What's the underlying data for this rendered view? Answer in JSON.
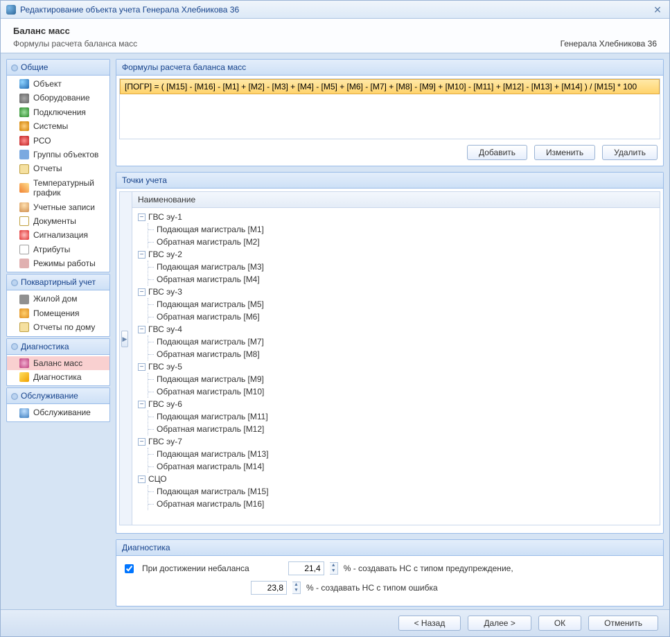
{
  "window": {
    "title": "Редактирование объекта учета Генерала Хлебникова 36"
  },
  "header": {
    "title": "Баланс масс",
    "subtitle": "Формулы расчета баланса масс",
    "object": "Генерала Хлебникова 36"
  },
  "sidebar": {
    "sections": {
      "common": {
        "title": "Общие",
        "items": [
          "Объект",
          "Оборудование",
          "Подключения",
          "Системы",
          "РСО",
          "Группы объектов",
          "Отчеты",
          "Температурный график",
          "Учетные записи",
          "Документы",
          "Сигнализация",
          "Атрибуты",
          "Режимы работы"
        ]
      },
      "apartment": {
        "title": "Поквартирный учет",
        "items": [
          "Жилой дом",
          "Помещения",
          "Отчеты по дому"
        ]
      },
      "diagnostics": {
        "title": "Диагностика",
        "items": [
          "Баланс масс",
          "Диагностика"
        ],
        "selected": 0
      },
      "service": {
        "title": "Обслуживание",
        "items": [
          "Обслуживание"
        ]
      }
    }
  },
  "formulas": {
    "panel_title": "Формулы расчета баланса масс",
    "row": "[ПОГР] = ( [M15] - [M16] - [M1] + [M2] - [M3] + [M4] - [M5] + [M6] - [M7] + [M8] - [M9] + [M10] - [M11] + [M12] - [M13] + [M14] ) / [M15] * 100",
    "buttons": {
      "add": "Добавить",
      "edit": "Изменить",
      "delete": "Удалить"
    }
  },
  "points": {
    "panel_title": "Точки учета",
    "column": "Наименование",
    "nodes": [
      {
        "label": "ГВС эу-1",
        "children": [
          "Подающая магистраль [M1]",
          "Обратная магистраль [M2]"
        ]
      },
      {
        "label": "ГВС эу-2",
        "children": [
          "Подающая магистраль [M3]",
          "Обратная магистраль [M4]"
        ]
      },
      {
        "label": "ГВС эу-3",
        "children": [
          "Подающая магистраль [M5]",
          "Обратная магистраль [M6]"
        ]
      },
      {
        "label": "ГВС эу-4",
        "children": [
          "Подающая магистраль [M7]",
          "Обратная магистраль [M8]"
        ]
      },
      {
        "label": "ГВС эу-5",
        "children": [
          "Подающая магистраль [M9]",
          "Обратная магистраль [M10]"
        ]
      },
      {
        "label": "ГВС эу-6",
        "children": [
          "Подающая магистраль [M11]",
          "Обратная магистраль [M12]"
        ]
      },
      {
        "label": "ГВС эу-7",
        "children": [
          "Подающая магистраль [M13]",
          "Обратная магистраль [M14]"
        ]
      },
      {
        "label": "СЦО",
        "children": [
          "Подающая магистраль [M15]",
          "Обратная магистраль [M16]"
        ]
      }
    ]
  },
  "diagnostics": {
    "panel_title": "Диагностика",
    "checkbox_label": "При достижении небаланса",
    "warn_value": "21,4",
    "warn_text": "% - создавать НС с типом предупреждение,",
    "err_value": "23,8",
    "err_text": "% - создавать НС с типом ошибка"
  },
  "footer": {
    "back": "< Назад",
    "next": "Далее >",
    "ok": "ОК",
    "cancel": "Отменить"
  }
}
